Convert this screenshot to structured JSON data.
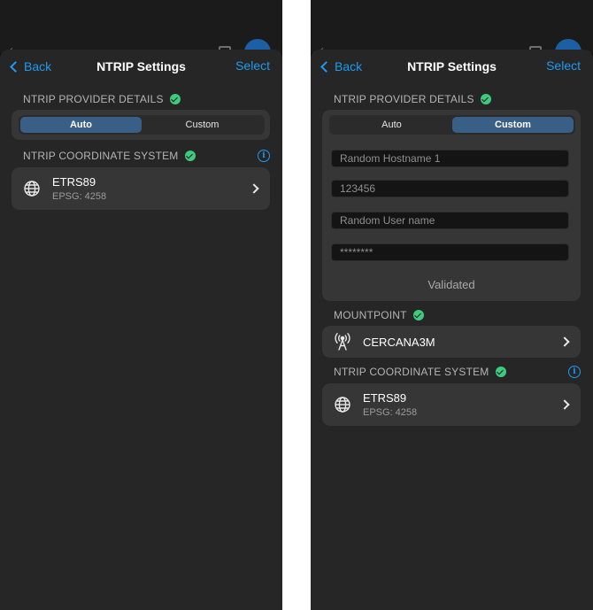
{
  "left_screen": {
    "nav": {
      "back_label": "Back",
      "title": "NTRIP Settings",
      "select_label": "Select"
    },
    "provider_section": {
      "label": "NTRIP PROVIDER DETAILS",
      "status_icon": "checkmark-circle-icon"
    },
    "segmented": {
      "options": [
        "Auto",
        "Custom"
      ],
      "selected": "Auto"
    },
    "coordinate_section": {
      "label": "NTRIP COORDINATE SYSTEM",
      "status_icon": "checkmark-circle-icon",
      "info_icon": "info-icon"
    },
    "coordinate_row": {
      "icon": "globe-icon",
      "title": "ETRS89",
      "subtitle": "EPSG: 4258"
    }
  },
  "right_screen": {
    "nav": {
      "back_label": "Back",
      "title": "NTRIP Settings",
      "select_label": "Select"
    },
    "provider_section": {
      "label": "NTRIP PROVIDER DETAILS",
      "status_icon": "checkmark-circle-icon"
    },
    "segmented": {
      "options": [
        "Auto",
        "Custom"
      ],
      "selected": "Custom"
    },
    "fields": {
      "hostname": "Random Hostname 1",
      "port": "123456",
      "username": "Random User name",
      "password": "********"
    },
    "validation_status": "Validated",
    "mountpoint_section": {
      "label": "MOUNTPOINT",
      "status_icon": "checkmark-circle-icon"
    },
    "mountpoint_row": {
      "icon": "antenna-icon",
      "title": "CERCANA3M"
    },
    "coordinate_section": {
      "label": "NTRIP COORDINATE SYSTEM",
      "status_icon": "checkmark-circle-icon",
      "info_icon": "info-icon"
    },
    "coordinate_row": {
      "icon": "globe-icon",
      "title": "ETRS89",
      "subtitle": "EPSG: 4258"
    }
  },
  "colors": {
    "accent": "#1e9bf0",
    "success": "#3ccb7f",
    "segment_active": "#3a5f87",
    "card": "#363636",
    "sheet": "#262626"
  }
}
